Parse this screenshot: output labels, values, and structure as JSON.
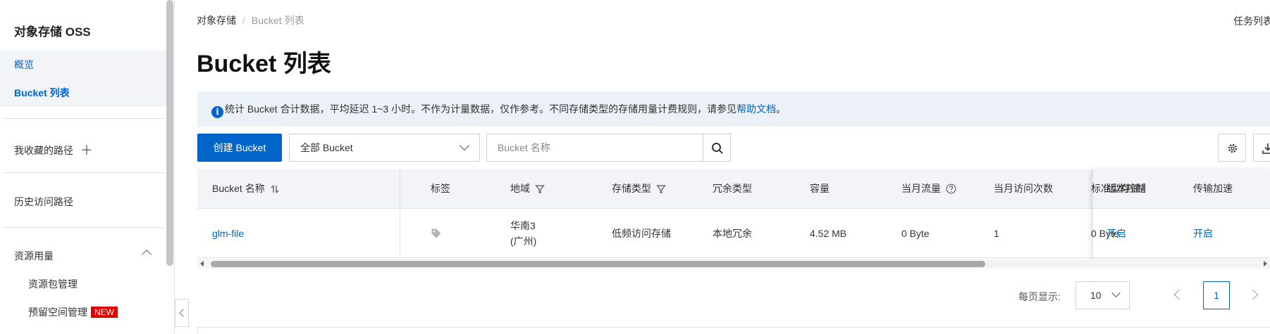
{
  "sidebar": {
    "title": "对象存储 OSS",
    "overview": "概览",
    "bucket_list": "Bucket 列表",
    "favorites": "我收藏的路径",
    "history": "历史访问路径",
    "resource_usage": "资源用量",
    "resource_pack": "资源包管理",
    "reserved_space": "预留空间管理",
    "new_badge": "NEW"
  },
  "breadcrumb": {
    "root": "对象存储",
    "separator": "/",
    "current": "Bucket 列表"
  },
  "header": {
    "task_list": "任务列表"
  },
  "page_title": "Bucket 列表",
  "notice": {
    "text": "统计 Bucket 合计数据，平均延迟 1~3 小时。不作为计量数据，仅作参考。不同存储类型的存储用量计费规则，请参见",
    "link": "帮助文档",
    "end": "。"
  },
  "toolbar": {
    "create_label": "创建 Bucket",
    "filter_value": "全部 Bucket",
    "search_placeholder": "Bucket 名称"
  },
  "table": {
    "columns": {
      "name": "Bucket 名称",
      "tags": "标签",
      "region": "地域",
      "storage_class": "存储类型",
      "redundancy": "冗余类型",
      "capacity": "容量",
      "monthly_traffic": "当月流量",
      "monthly_visits": "当月访问次数",
      "standard_storage": "标准型存储量",
      "versioning": "版本控制",
      "acceleration": "传输加速"
    },
    "rows": [
      {
        "name": "glm-file",
        "region_line1": "华南3",
        "region_line2": "(广州)",
        "storage_class": "低频访问存储",
        "redundancy": "本地冗余",
        "capacity": "4.52 MB",
        "monthly_traffic": "0 Byte",
        "monthly_visits": "1",
        "standard_storage": "0 Byte",
        "versioning": "开启",
        "acceleration": "开启"
      }
    ]
  },
  "pagination": {
    "label": "每页显示:",
    "page_size": "10",
    "current_page": "1"
  },
  "colors": {
    "primary": "#0064c8",
    "notice_bg": "#ecf1f8",
    "header_bg": "#f2f4f7",
    "badge": "#dd0000"
  }
}
